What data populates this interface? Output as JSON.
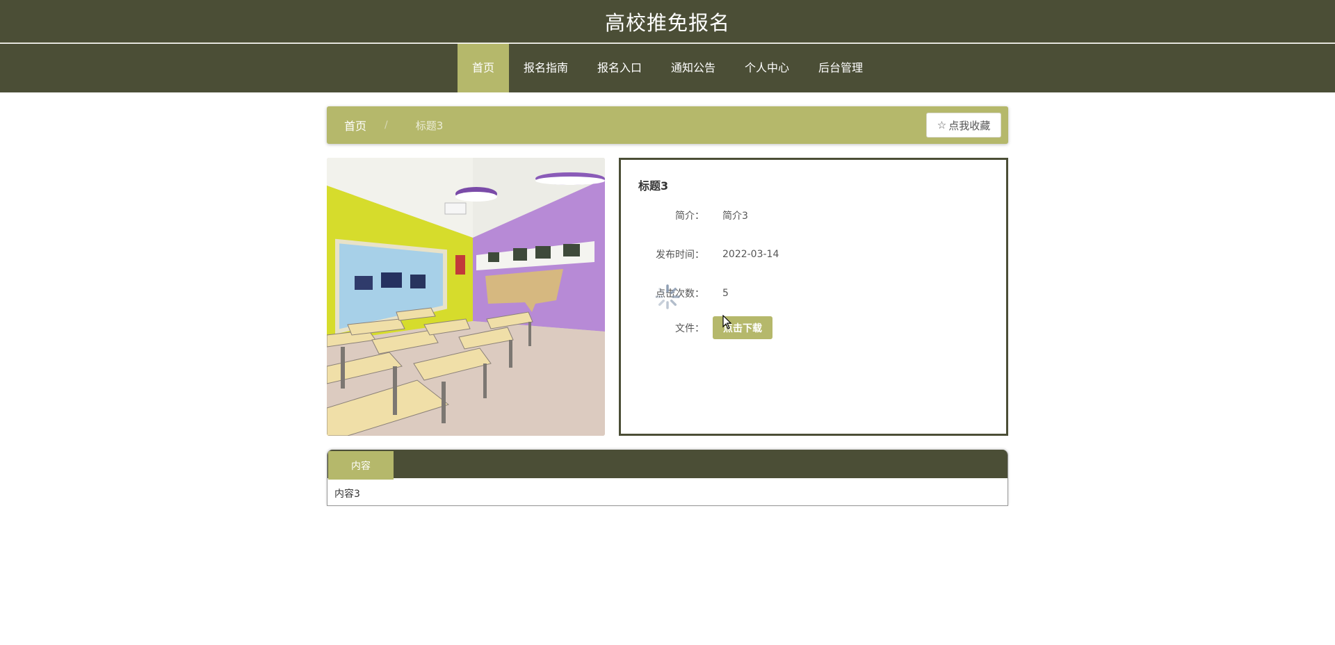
{
  "header": {
    "site_title": "高校推免报名"
  },
  "nav": {
    "items": [
      {
        "label": "首页",
        "active": true
      },
      {
        "label": "报名指南",
        "active": false
      },
      {
        "label": "报名入口",
        "active": false
      },
      {
        "label": "通知公告",
        "active": false
      },
      {
        "label": "个人中心",
        "active": false
      },
      {
        "label": "后台管理",
        "active": false
      }
    ]
  },
  "breadcrumb": {
    "home": "首页",
    "separator": "/",
    "current": "标题3"
  },
  "favorite_button": {
    "icon": "star-outline-icon",
    "label": "点我收藏"
  },
  "detail": {
    "title": "标题3",
    "summary_label": "简介：",
    "summary_value": "简介3",
    "publish_label": "发布时间：",
    "publish_value": "2022-03-14",
    "clicks_label": "点击次数：",
    "clicks_value": "5",
    "file_label": "文件：",
    "download_label": "点击下载"
  },
  "tabs": {
    "active_label": "内容",
    "content": "内容3"
  },
  "colors": {
    "primary": "#4b4e36",
    "accent": "#b5b86b"
  }
}
